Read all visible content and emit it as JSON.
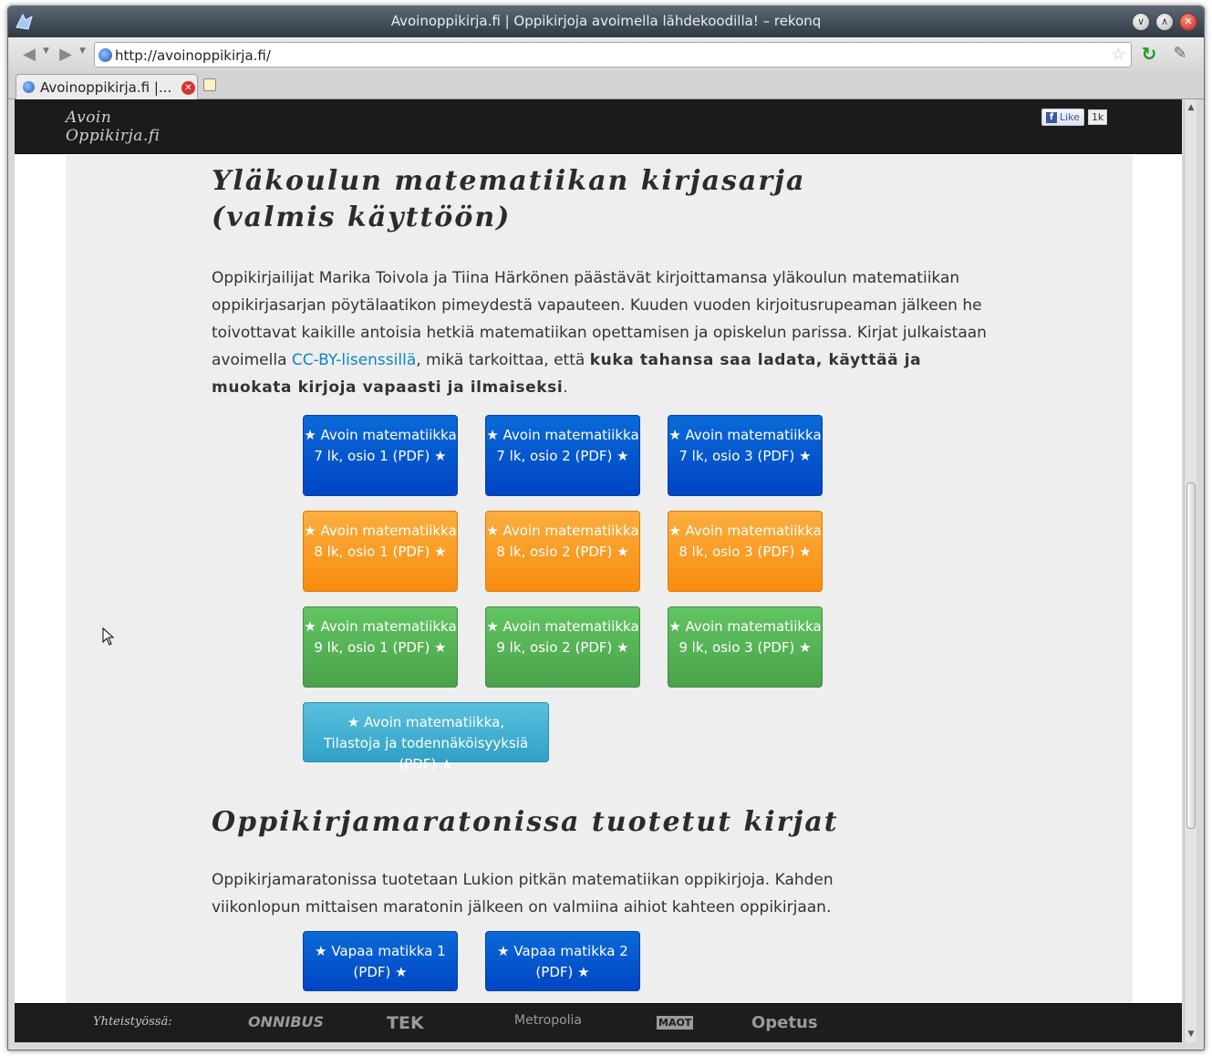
{
  "window": {
    "title": "Avoinoppikirja.fi | Oppikirjoja avoimella lähdekoodilla! – rekonq"
  },
  "toolbar": {
    "back_icon": "back-arrow-icon",
    "forward_icon": "forward-arrow-icon",
    "url": "http://avoinoppikirja.fi/",
    "reload_icon": "reload-icon",
    "tools_icon": "wrench-icon"
  },
  "tabs": [
    {
      "label": "Avoinoppikirja.fi |...",
      "active": true
    }
  ],
  "site": {
    "logo": "Avoin Oppikirja.fi",
    "logo_line1": "Avoin",
    "logo_line2": "Oppikirja.fi",
    "fb_like_label": "Like",
    "fb_like_count": "1k",
    "section1": {
      "heading": "Yläkoulun matematiikan kirjasarja (valmis käyttöön)",
      "intro": "Oppikirjailijat Marika Toivola ja Tiina Härkönen päästävät kirjoittamansa yläkoulun matematiikan oppikirjasarjan pöytälaatikon pimeydestä vapauteen. Kuuden vuoden kirjoitusrupeaman jälkeen he toivottavat kaikille antoisia hetkiä matematiikan opettamisen ja opiskelun parissa. Kirjat julkaistaan avoimella ",
      "link": "CC-BY-lisenssillä",
      "middle": ", mikä tarkoittaa, että ",
      "strong": "kuka tahansa saa ladata, käyttää ja muokata kirjoja vapaasti ja ilmaiseksi",
      "end": ".",
      "buttons": [
        {
          "label": "★ Avoin matematiikka 7 lk, osio 1 (PDF) ★",
          "color": "blue"
        },
        {
          "label": "★ Avoin matematiikka 7 lk, osio 2 (PDF) ★",
          "color": "blue"
        },
        {
          "label": "★ Avoin matematiikka 7 lk, osio 3 (PDF) ★",
          "color": "blue"
        },
        {
          "label": "★ Avoin matematiikka 8 lk, osio 1 (PDF) ★",
          "color": "orange"
        },
        {
          "label": "★ Avoin matematiikka 8 lk, osio 2 (PDF) ★",
          "color": "orange"
        },
        {
          "label": "★ Avoin matematiikka 8 lk, osio 3 (PDF) ★",
          "color": "orange"
        },
        {
          "label": "★ Avoin matematiikka 9 lk, osio 1 (PDF) ★",
          "color": "green"
        },
        {
          "label": "★ Avoin matematiikka 9 lk, osio 2 (PDF) ★",
          "color": "green"
        },
        {
          "label": "★ Avoin matematiikka 9 lk, osio 3 (PDF) ★",
          "color": "green"
        },
        {
          "label": "★ Avoin matematiikka, Tilastoja ja todennäköisyyksiä (PDF) ★",
          "color": "cyan"
        }
      ]
    },
    "section2": {
      "heading": "Oppikirjamaratonissa tuotetut kirjat",
      "intro": "Oppikirjamaratonissa tuotetaan Lukion pitkän matematiikan oppikirjoja. Kahden viikonlopun mittaisen maratonin jälkeen on valmiina aihiot kahteen oppikirjaan.",
      "buttons": [
        {
          "label": "★ Vapaa matikka 1 (PDF) ★",
          "color": "blue"
        },
        {
          "label": "★ Vapaa matikka 2 (PDF) ★",
          "color": "blue"
        }
      ]
    },
    "footer": {
      "label": "Yhteistyössä:",
      "partners": [
        "ONNIBUS",
        "TEK",
        "Metropolia",
        "MAOT",
        "Opetus"
      ]
    }
  },
  "colors": {
    "blue_button": "#0055cc",
    "orange_button": "#f89406",
    "green_button": "#51a351",
    "cyan_button": "#49afcd",
    "link": "#0b85c6",
    "header_bg": "#1b1b1b",
    "content_bg": "#eeeeee"
  }
}
